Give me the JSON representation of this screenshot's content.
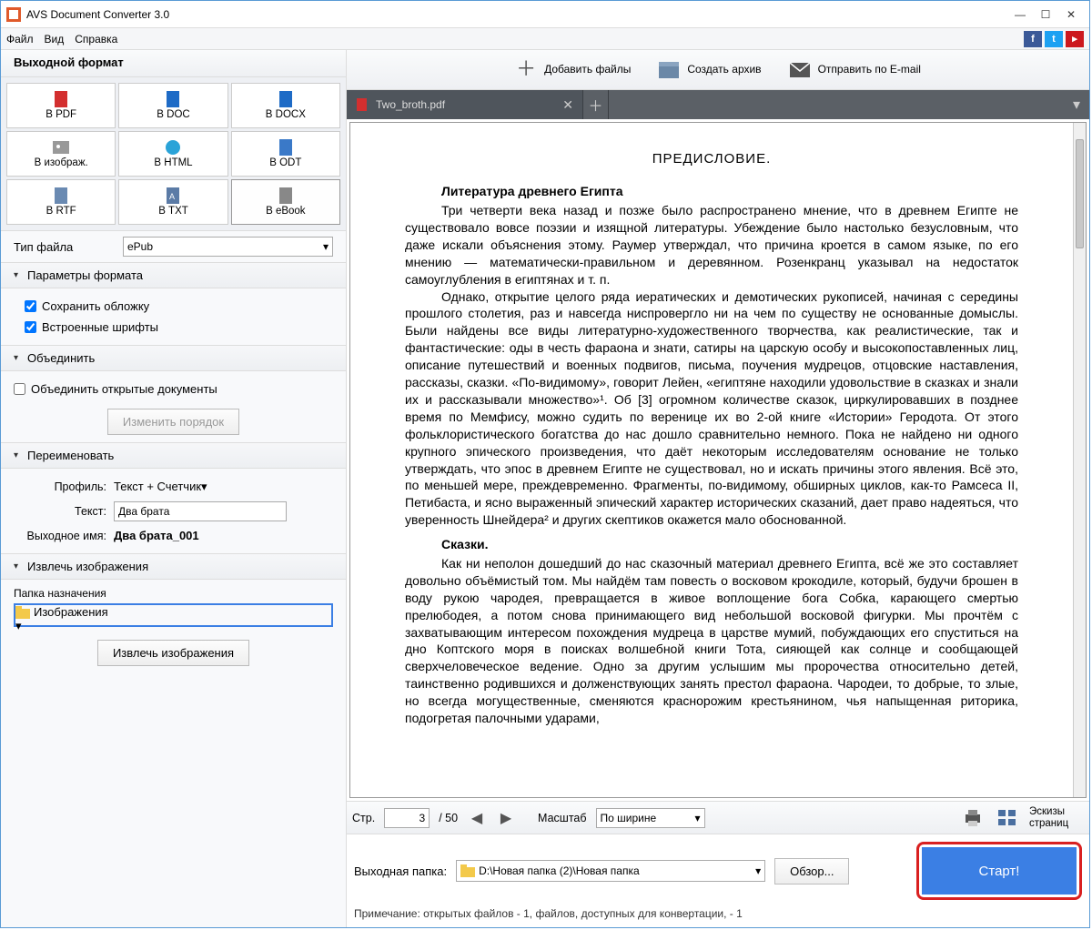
{
  "window": {
    "title": "AVS Document Converter 3.0"
  },
  "menu": {
    "file": "Файл",
    "view": "Вид",
    "help": "Справка"
  },
  "sidebar": {
    "header": "Выходной формат",
    "formats": [
      {
        "label": "В PDF"
      },
      {
        "label": "В DOC"
      },
      {
        "label": "В DOCX"
      },
      {
        "label": "В изображ."
      },
      {
        "label": "В HTML"
      },
      {
        "label": "В ODT"
      },
      {
        "label": "В RTF"
      },
      {
        "label": "В TXT"
      },
      {
        "label": "В eBook"
      }
    ],
    "file_type_label": "Тип файла",
    "file_type_value": "ePub",
    "sect_format": "Параметры формата",
    "chk_cover": "Сохранить обложку",
    "chk_fonts": "Встроенные шрифты",
    "sect_merge": "Объединить",
    "chk_merge": "Объединить открытые документы",
    "btn_reorder": "Изменить порядок",
    "sect_rename": "Переименовать",
    "profile_label": "Профиль:",
    "profile_value": "Текст + Счетчик",
    "text_label": "Текст:",
    "text_value": "Два брата",
    "outname_label": "Выходное имя:",
    "outname_value": "Два брата_001",
    "sect_extract": "Извлечь изображения",
    "dest_label": "Папка назначения",
    "dest_value": "Изображения",
    "btn_extract": "Извлечь изображения"
  },
  "top_actions": {
    "add": "Добавить файлы",
    "archive": "Создать архив",
    "email": "Отправить по E-mail"
  },
  "tab": {
    "name": "Two_broth.pdf"
  },
  "document": {
    "heading": "ПРЕДИСЛОВИЕ.",
    "sub1": "Литература древнего Египта",
    "p1": "Три четверти века назад и позже было распространено мнение, что в древнем Египте не существовало вовсе поэзии и изящной литературы. Убеждение было настолько безусловным, что даже искали объяснения этому. Раумер утверждал, что причина кроется в самом языке, по его мнению — математически-правильном и деревянном. Розенкранц указывал на недостаток самоуглубления в египтянах и т. п.",
    "p2": "Однако, открытие целого ряда иератических и демотических рукописей, начиная с середины прошлого столетия, раз и навсегда ниспровергло ни на чем по существу не основанные домыслы. Были найдены все виды литературно-художественного творчества, как реалистические, так и фантастические: оды в честь фараона и знати, сатиры на царскую особу и высокопоставленных лиц, описание путешествий и военных подвигов, письма, поучения мудрецов, отцовские наставления, рассказы, сказки. «По-видимому», говорит Лейен, «египтяне находили удовольствие в сказках и знали их и рассказывали множество»¹. Об [3] огромном количестве сказок, циркулировавших в позднее время по Мемфису, можно судить по веренице их во 2-ой книге «Истории» Геродота. От этого фольклористического богатства до нас дошло сравнительно немного. Пока не найдено ни одного крупного эпического произведения, что даёт некоторым исследователям основание не только утверждать, что эпос в древнем Египте не существовал, но и искать причины этого явления. Всё это, по меньшей мере, преждевременно. Фрагменты, по-видимому, обширных циклов, как-то Рамсеса II, Петибаста, и ясно выраженный эпический характер исторических сказаний, дает право надеяться, что уверенность Шнейдера² и других скептиков окажется мало обоснованной.",
    "sub2": "Сказки.",
    "p3": "Как ни неполон дошедший до нас сказочный материал древнего Египта, всё же это составляет довольно объёмистый том. Мы найдём там повесть о восковом крокодиле, который, будучи брошен в воду рукою чародея, превращается в живое воплощение бога Собка, карающего смертью прелюбодея, а потом снова принимающего вид небольшой восковой фигурки. Мы прочтём с захватывающим интересом похождения мудреца в царстве мумий, побуждающих его спуститься на дно Коптского моря в поисках волшебной книги Тота, сияющей как солнце и сообщающей сверхчеловеческое ведение. Одно за другим услышим мы пророчества относительно детей, таинственно родившихся и долженствующих занять престол фараона. Чародеи, то добрые, то злые, но всегда могущественные, сменяются краснорожим крестьянином, чья напыщенная риторика, подогретая палочными ударами,"
  },
  "pagebar": {
    "label": "Стр.",
    "current": "3",
    "total": "/ 50",
    "zoom_label": "Масштаб",
    "zoom_value": "По ширине",
    "thumbs": "Эскизы страниц"
  },
  "footer": {
    "out_label": "Выходная папка:",
    "out_path": "D:\\Новая папка (2)\\Новая папка",
    "browse": "Обзор...",
    "start": "Старт!",
    "note": "Примечание: открытых файлов - 1, файлов, доступных для конвертации, - 1"
  }
}
